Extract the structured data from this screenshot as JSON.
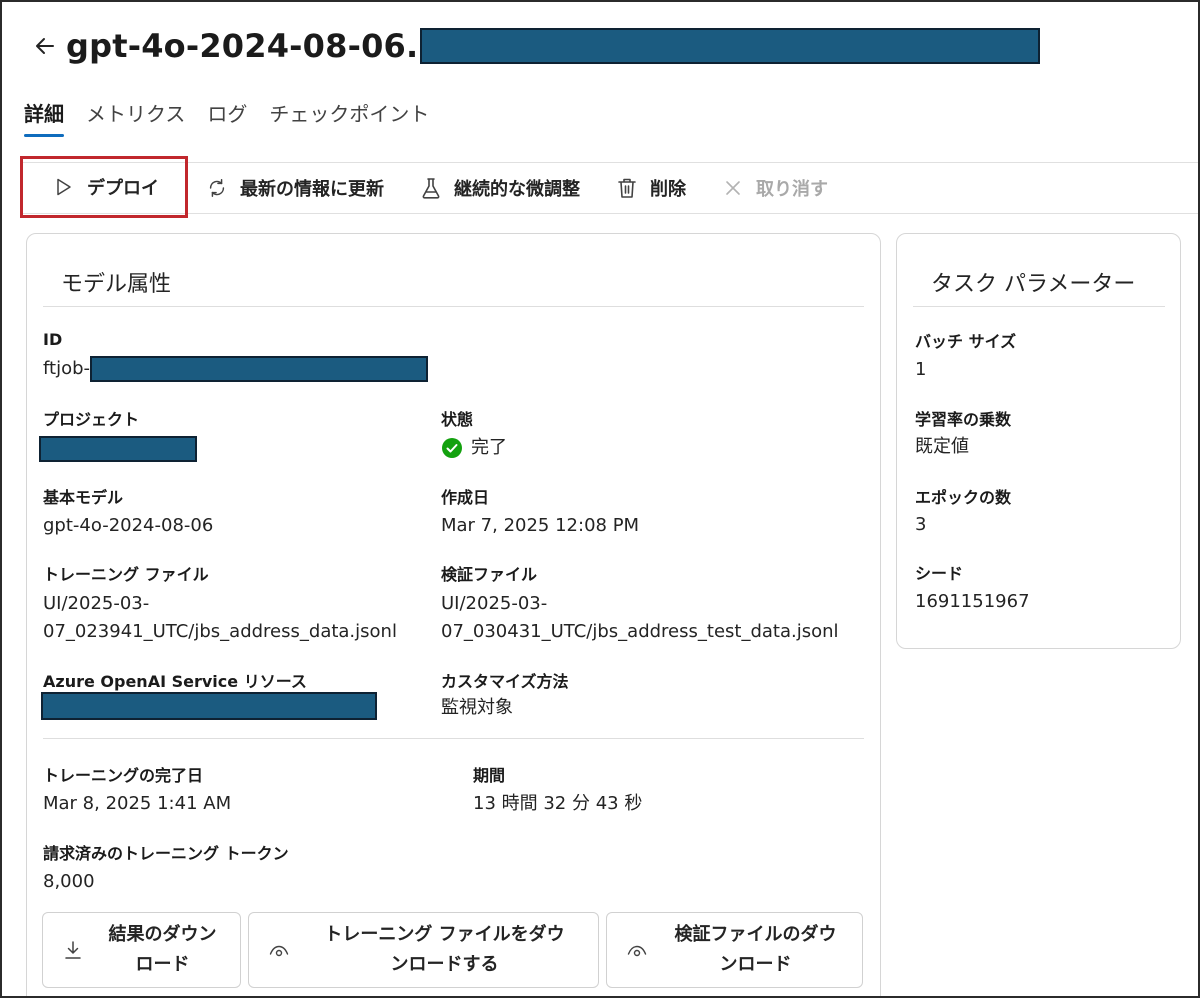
{
  "header": {
    "title": "gpt-4o-2024-08-06."
  },
  "tabs": [
    {
      "label": "詳細"
    },
    {
      "label": "メトリクス"
    },
    {
      "label": "ログ"
    },
    {
      "label": "チェックポイント"
    }
  ],
  "toolbar": {
    "deploy": "デプロイ",
    "refresh": "最新の情報に更新",
    "continuous_finetune": "継続的な微調整",
    "delete": "削除",
    "cancel": "取り消す"
  },
  "model_attributes": {
    "title": "モデル属性",
    "id_label": "ID",
    "id_value_prefix": "ftjob-",
    "project_label": "プロジェクト",
    "status_label": "状態",
    "status_value": "完了",
    "base_model_label": "基本モデル",
    "base_model_value": "gpt-4o-2024-08-06",
    "created_label": "作成日",
    "created_value": "Mar 7, 2025 12:08 PM",
    "training_file_label": "トレーニング ファイル",
    "training_file_line1": "UI/2025-03-",
    "training_file_line2": "07_023941_UTC/jbs_address_data.jsonl",
    "validation_file_label": "検証ファイル",
    "validation_file_line1": "UI/2025-03-",
    "validation_file_line2": "07_030431_UTC/jbs_address_test_data.jsonl",
    "resource_label": "Azure OpenAI Service リソース",
    "customize_label": "カスタマイズ方法",
    "customize_value": "監視対象",
    "completed_label": "トレーニングの完了日",
    "completed_value": "Mar 8, 2025 1:41 AM",
    "duration_label": "期間",
    "duration_value": "13 時間 32 分 43 秒",
    "tokens_label": "請求済みのトレーニング トークン",
    "tokens_value": "8,000"
  },
  "downloads": {
    "results_line1": "結果のダウン",
    "results_line2": "ロード",
    "training_line1": "トレーニング ファイルをダウ",
    "training_line2": "ンロードする",
    "validation_line1": "検証ファイルのダウ",
    "validation_line2": "ンロード"
  },
  "task_params": {
    "title": "タスク パラメーター",
    "batch_size_label": "バッチ サイズ",
    "batch_size_value": "1",
    "lr_mult_label": "学習率の乗数",
    "lr_mult_value": "既定値",
    "epochs_label": "エポックの数",
    "epochs_value": "3",
    "seed_label": "シード",
    "seed_value": "1691151967"
  },
  "colors": {
    "accent": "#0f6cbd",
    "success": "#13a10e",
    "highlight_border": "#c1272d",
    "redaction": "#1b5b80"
  },
  "icons": {
    "back": "arrow-left-icon",
    "deploy": "play-icon",
    "refresh": "refresh-icon",
    "continuous_finetune": "beaker-icon",
    "delete": "trash-icon",
    "cancel": "dismiss-icon",
    "status": "checkmark-circle-icon",
    "download": "download-icon",
    "view": "eye-icon"
  }
}
